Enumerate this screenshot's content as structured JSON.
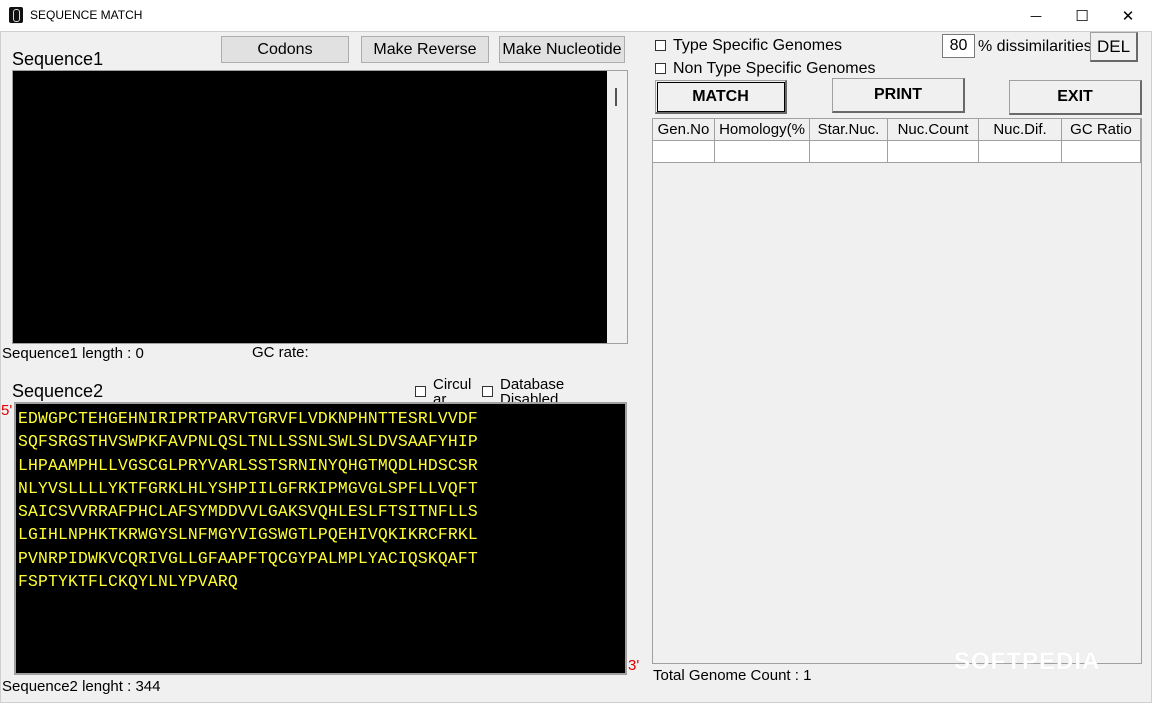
{
  "window": {
    "title": "SEQUENCE MATCH",
    "minimize": "—",
    "maximize": "☐",
    "close": "✕"
  },
  "toolbar": {
    "codons": "Codons",
    "make_reverse": "Make Reverse",
    "make_nucleotide": "Make Nucleotide"
  },
  "seq1": {
    "label": "Sequence1",
    "length_label": "Sequence1 length : 0",
    "gc_label": "GC rate:"
  },
  "seq2": {
    "label": "Sequence2",
    "circular_label_line1": "Circul",
    "circular_label_line2": "ar",
    "database_label_line1": "Database",
    "database_label_line2": "Disabled",
    "five_prime": "5'",
    "three_prime": "3'",
    "length_label": "Sequence2 lenght : 344",
    "lines": [
      "EDWGPCTEHGEHNIRIPRTPARVTGRVFLVDKNPHNTTESRLVVDF",
      "SQFSRGSTHVSWPKFAVPNLQSLTNLLSSNLSWLSLDVSAAFYHIP",
      "LHPAAMPHLLVGSCGLPRYVARLSSTSRNINYQHGTMQDLHDSCSR",
      "NLYVSLLLLYKTFGRKLHLYSHPIILGFRKIPMGVGLSPFLLVQFT",
      "SAICSVVRRAFPHCLAFSYMDDVVLGAKSVQHLESLFTSITNFLLS",
      "LGIHLNPHKTKRWGYSLNFMGYVIGSWGTLPQEHIVQKIKRCFRKL",
      "PVNRPIDWKVCQRIVGLLGFAAPFTQCGYPALMPLYACIQSKQAFT",
      "FSPTYKTFLCKQYLNLYPVARQ"
    ]
  },
  "options": {
    "type_specific": "Type Specific Genomes",
    "non_type_specific": "Non Type Specific Genomes",
    "dissimilarity_value": "80",
    "dissimilarity_label": "% dissimilarities",
    "del_button": "DEL"
  },
  "actions": {
    "match": "MATCH",
    "print": "PRINT",
    "exit": "EXIT"
  },
  "results": {
    "columns": [
      "Gen.No",
      "Homology(%",
      "Star.Nuc.",
      "Nuc.Count",
      "Nuc.Dif.",
      "GC Ratio"
    ],
    "total_label": "Total Genome Count : 1"
  },
  "watermark": "SOFTPEDIA",
  "colors": {
    "sequence_text": "#ffff33",
    "sequence_bg": "#000000",
    "prime_marker": "#e00000"
  }
}
